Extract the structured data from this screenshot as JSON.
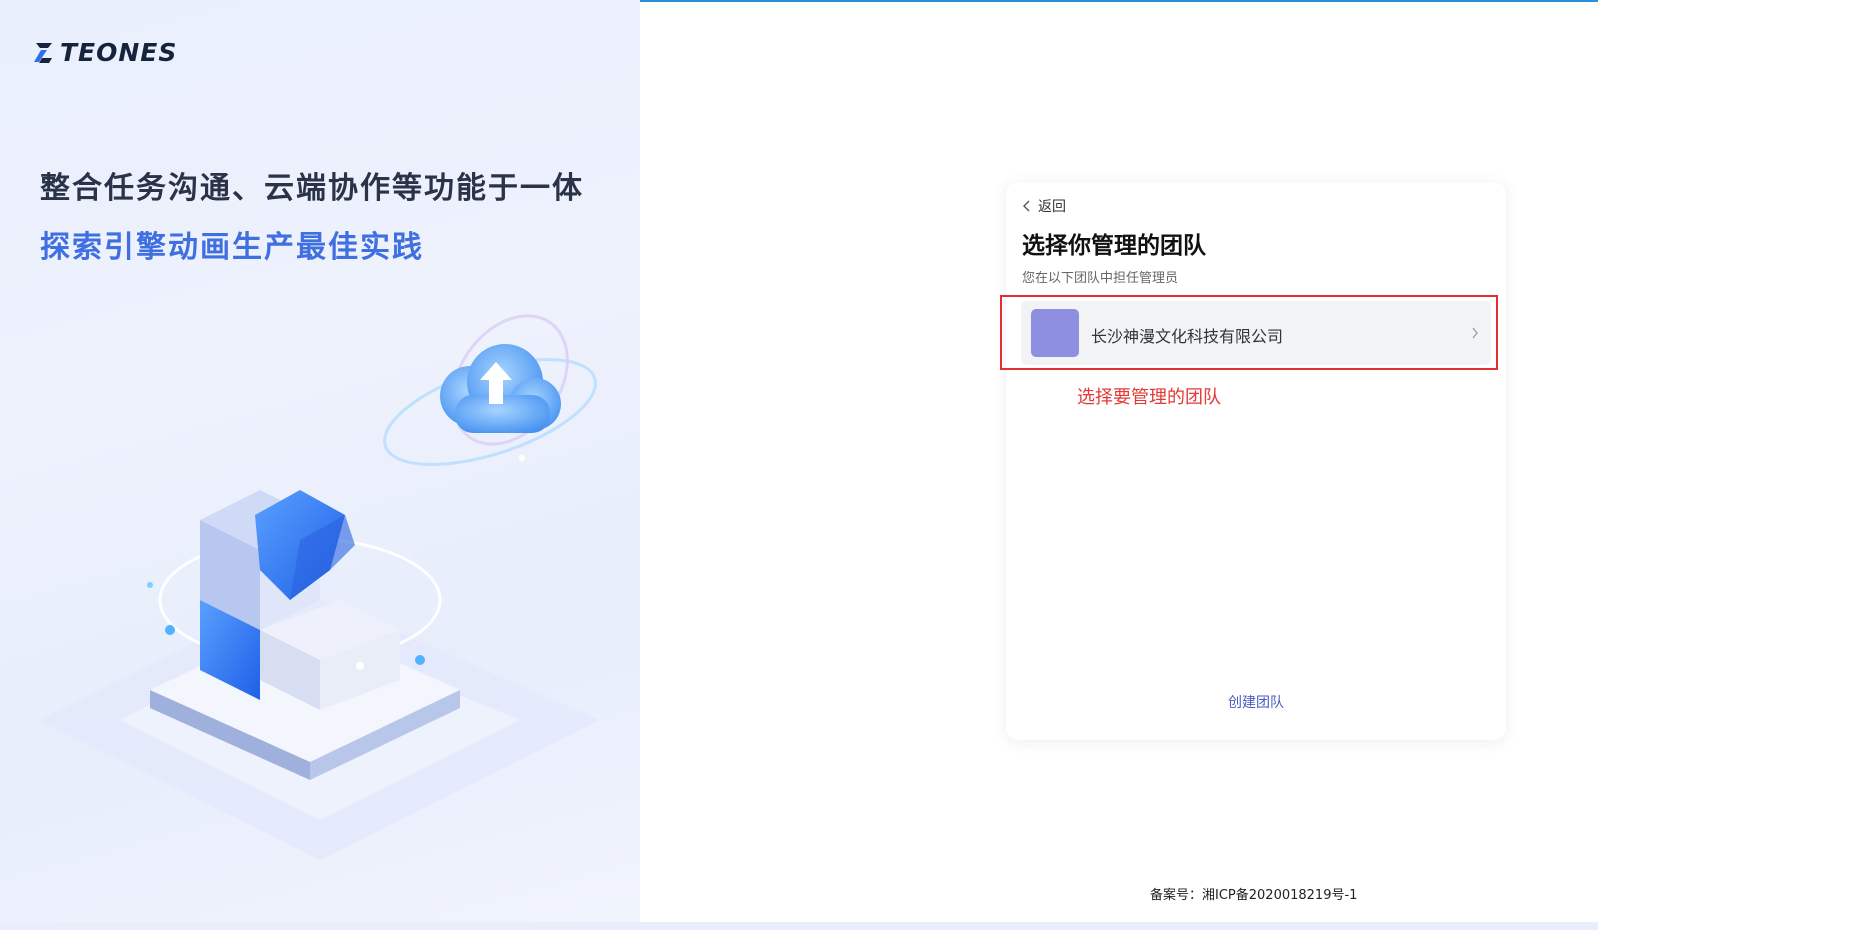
{
  "brand": {
    "logo_text": "TEONES"
  },
  "hero": {
    "tagline_primary": "整合任务沟通、云端协作等功能于一体",
    "tagline_secondary": "探索引擎动画生产最佳实践"
  },
  "card": {
    "back_label": "返回",
    "title": "选择你管理的团队",
    "subtitle": "您在以下团队中担任管理员",
    "teams": [
      {
        "name": "长沙神漫文化科技有限公司",
        "avatar_color": "#8e8fe0"
      }
    ],
    "annotation": "选择要管理的团队",
    "create_team_label": "创建团队"
  },
  "footer": {
    "icp": "备案号：湘ICP备2020018219号-1"
  },
  "colors": {
    "accent_blue": "#3f6fe0",
    "link": "#4a5bbf",
    "annotation_red": "#e53935",
    "top_line": "#2d8fd6"
  }
}
